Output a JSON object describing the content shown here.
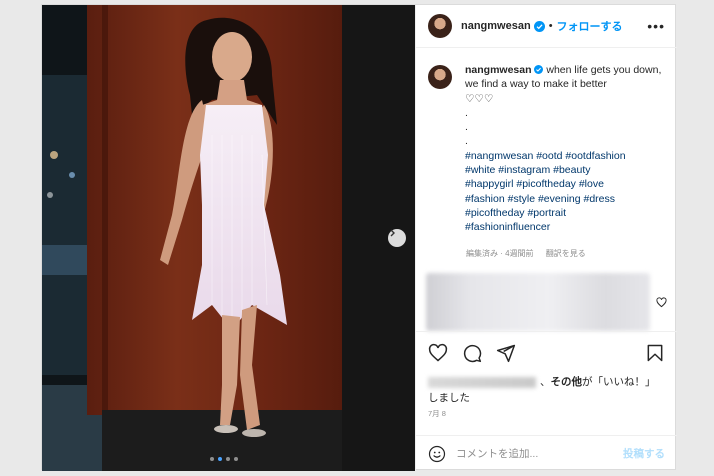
{
  "header": {
    "username": "nangmwesan",
    "separator": "•",
    "follow_label": "フォローする",
    "more_label": "•••"
  },
  "caption": {
    "username": "nangmwesan",
    "text": "when life gets you down, we find a way to make it better",
    "hearts": "♡♡♡",
    "dots": [
      ".",
      ".",
      "."
    ],
    "hashtags": [
      "#nangmwesan #ootd #ootdfashion",
      "#white #instagram #beauty",
      "#happygirl #picoftheday #love",
      "#fashion #style #evening #dress",
      "#picoftheday #portrait",
      "#fashioninfluencer"
    ],
    "meta_edited": "編集済み · 4週間前",
    "meta_translate": "翻訳を見る"
  },
  "likes": {
    "suffix_prefix": "、",
    "others_label": "その他",
    "suffix_text": "が「いいね！」",
    "line2": "しました"
  },
  "date": "7月 8",
  "comment_input": {
    "placeholder": "コメントを追加...",
    "post_label": "投稿する"
  },
  "colors": {
    "accent": "#0095f6",
    "hashtag": "#00376b",
    "muted": "#8e8e8e"
  },
  "carousel": {
    "slides": 4,
    "active_index": 1
  }
}
